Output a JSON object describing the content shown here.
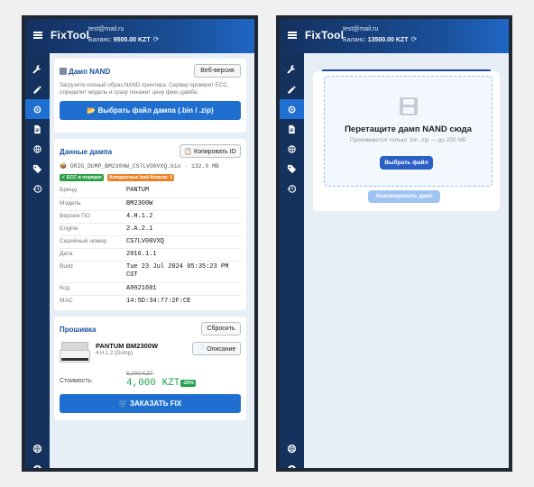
{
  "header": {
    "brand": "FixTool",
    "email": "test@mail.ru",
    "balance_label": "Баланс:",
    "balance_value_1": "9500.00 KZT",
    "balance_value_2": "13500.00 KZT"
  },
  "sidebar": {
    "items": [
      "wrench-icon",
      "pencil-icon",
      "chip-icon",
      "document-icon",
      "globe-icon",
      "tag-icon",
      "history-icon"
    ],
    "bottom": [
      "lifebuoy-icon",
      "user-icon"
    ]
  },
  "nand": {
    "title": "Дамп NAND",
    "web_button": "Веб-версия",
    "description": "Загрузите полный образ NAND принтера. Сервер проверит ECC, определит модель и сразу покажет цену фикс-дамба.",
    "choose_button": "📂 Выбрать файл дампа (.bin / .zip)"
  },
  "dump": {
    "title": "Данные дампа",
    "copy_button": "📋 Копировать ID",
    "file_name": "📦 ORIG_DUMP_BM2300W_CS7LVO0VXQ.bin  ·  132.0 MB",
    "badge_ecc": "✓ ECC в порядке",
    "badge_bad": "Аппаратных bad-блоков: 1",
    "rows": [
      {
        "label": "Бренд",
        "value": "PANTUM"
      },
      {
        "label": "Модель",
        "value": "BM2300W"
      },
      {
        "label": "Версия ПО",
        "value": "4.H.1.2"
      },
      {
        "label": "Engine",
        "value": "2.A.2.1"
      },
      {
        "label": "Серийный номер",
        "value": "CS7LV00VXQ"
      },
      {
        "label": "Дата",
        "value": "2016.1.1"
      },
      {
        "label": "Build",
        "value": "Tue 23 Jul 2024 05:35:23 PM CST"
      },
      {
        "label": "Код",
        "value": "A9921601"
      },
      {
        "label": "MAC",
        "value": "14:5D:34:77:2F:CE"
      }
    ]
  },
  "firmware": {
    "title": "Прошивка",
    "reset_button": "Сбросить",
    "model": "PANTUM BM2300W",
    "version": "4.H.1.2 (Dump)",
    "desc_button": "📄 Описание",
    "price_label": "Стоимость:",
    "old_price": "5,000 KZT",
    "new_price": "4,000 KZT",
    "discount": "-20%",
    "order_button": "🛒 ЗАКАЗАТЬ FIX"
  },
  "upload": {
    "title": "Перетащите дамп NAND сюда",
    "hint": "Принимаются только .bin .zip — до 200 МБ",
    "choose_button": "Выбрать файл",
    "analyze_button": "Анализировать дамп"
  },
  "colors": {
    "header_dark": "#14305e",
    "accent": "#1f6fd1",
    "price_green": "#22a04b",
    "badge_orange": "#e8832a"
  }
}
